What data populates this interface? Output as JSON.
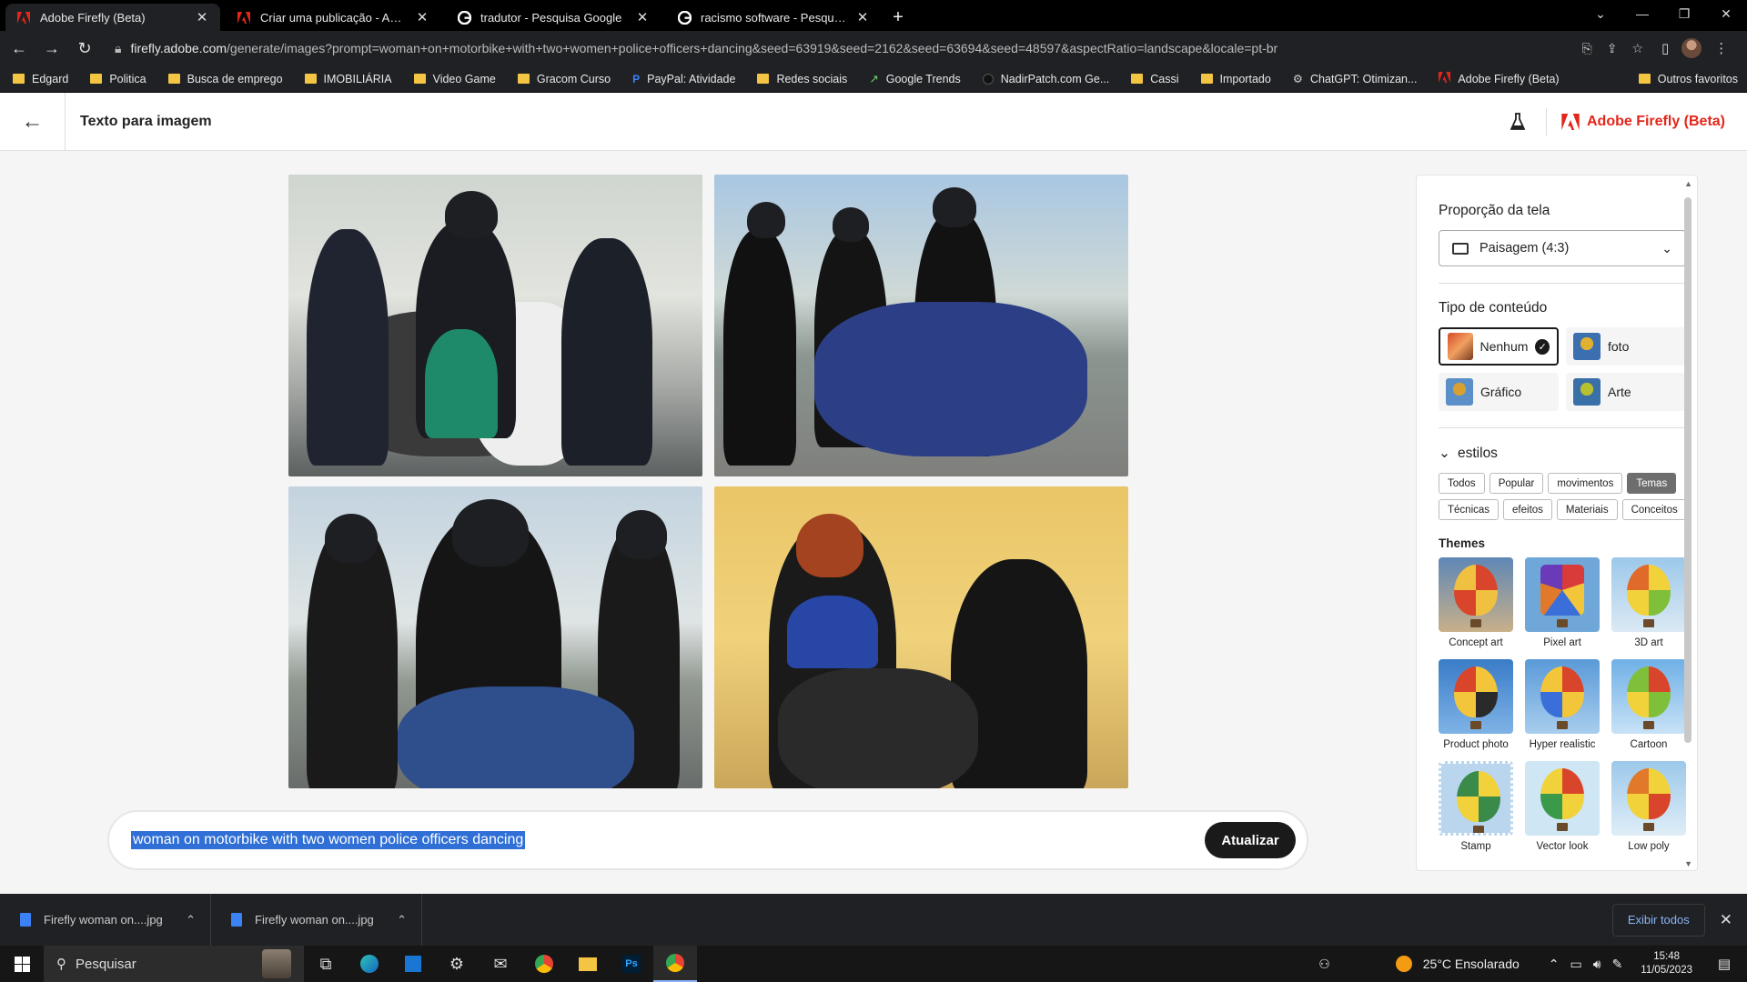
{
  "browser": {
    "tabs": [
      {
        "title": "Adobe Firefly (Beta)",
        "active": true,
        "icon": "adobe-icon"
      },
      {
        "title": "Criar uma publicação - Adobe Su",
        "active": false,
        "icon": "adobe-icon"
      },
      {
        "title": "tradutor - Pesquisa Google",
        "active": false,
        "icon": "google-icon"
      },
      {
        "title": "racismo software - Pesquisa Goo",
        "active": false,
        "icon": "google-icon"
      }
    ],
    "url_host": "firefly.adobe.com",
    "url_path": "/generate/images?prompt=woman+on+motorbike+with+two+women+police+officers+dancing&seed=63919&seed=2162&seed=63694&seed=48597&aspectRatio=landscape&locale=pt-br",
    "bookmarks": [
      "Edgard",
      "Politica",
      "Busca de emprego",
      "IMOBILIÁRIA",
      "Video Game",
      "Gracom Curso",
      "PayPal: Atividade",
      "Redes sociais",
      "Google Trends",
      "NadirPatch.com Ge...",
      "Cassi",
      "Importado",
      "ChatGPT: Otimizan...",
      "Adobe Firefly (Beta)"
    ],
    "bookmarks_other": "Outros favoritos"
  },
  "app": {
    "page_title": "Texto para imagem",
    "brand": "Adobe Firefly (Beta)",
    "brand_color": "#e4261a",
    "prompt": "woman on motorbike with two women police officers dancing",
    "update_label": "Atualizar"
  },
  "panel": {
    "aspect_title": "Proporção da tela",
    "aspect_value": "Paisagem (4:3)",
    "content_title": "Tipo de conteúdo",
    "content_types": [
      {
        "label": "Nenhum",
        "selected": true
      },
      {
        "label": "foto",
        "selected": false
      },
      {
        "label": "Gráfico",
        "selected": false
      },
      {
        "label": "Arte",
        "selected": false
      }
    ],
    "styles_title": "estilos",
    "chips_row1": [
      "Todos",
      "Popular",
      "movimentos",
      "Temas"
    ],
    "chips_row2": [
      "Técnicas",
      "efeitos",
      "Materiais",
      "Conceitos"
    ],
    "active_chip": "Temas",
    "themes_title": "Themes",
    "themes": [
      "Concept art",
      "Pixel art",
      "3D art",
      "Product photo",
      "Hyper realistic",
      "Cartoon",
      "Stamp",
      "Vector look",
      "Low poly"
    ]
  },
  "downloads": {
    "items": [
      "Firefly woman on....jpg",
      "Firefly woman on....jpg"
    ],
    "show_all": "Exibir todos"
  },
  "taskbar": {
    "search_placeholder": "Pesquisar",
    "weather": "25°C  Ensolarado",
    "time": "15:48",
    "date": "11/05/2023"
  }
}
